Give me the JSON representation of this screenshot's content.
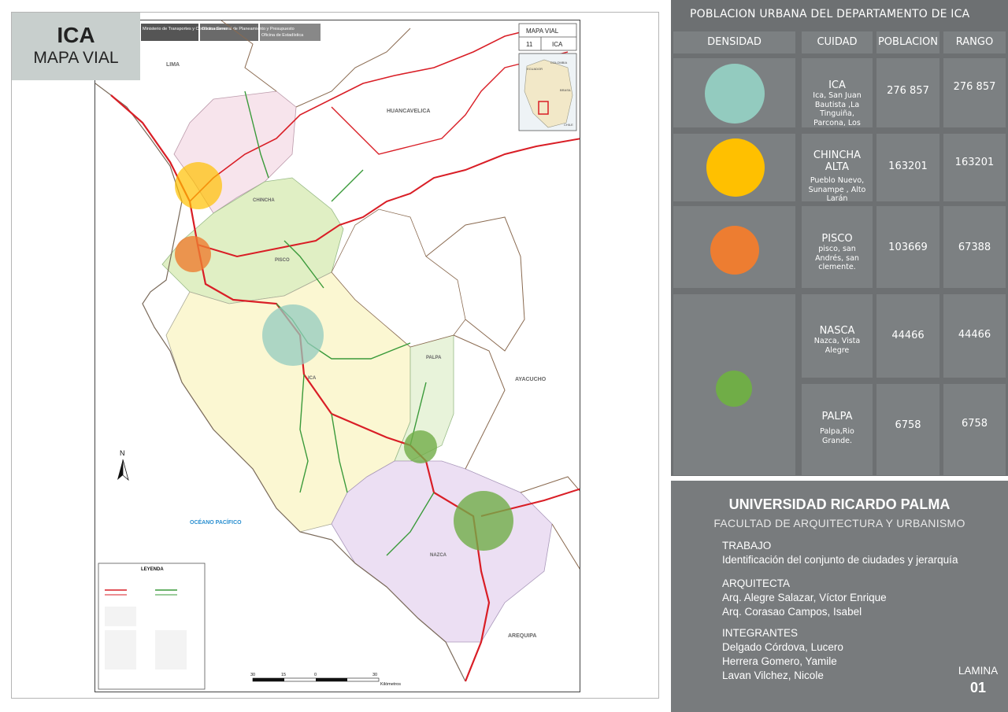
{
  "title": {
    "name": "ICA",
    "subtitle": "MAPA VIAL"
  },
  "map": {
    "header_logos": [
      "Ministerio de Transportes y Comunicaciones",
      "Oficina General de Planeamiento y Presupuesto",
      "Oficina de Estadística"
    ],
    "inset_label": "MAPA VIAL",
    "inset_number": "11",
    "inset_region": "ICA",
    "neighbors": [
      "LIMA",
      "HUANCAVELICA",
      "AYACUCHO",
      "AREQUIPA"
    ],
    "provinces": [
      "CHINCHA",
      "PISCO",
      "ICA",
      "PALPA",
      "NAZCA"
    ],
    "ocean": "OCÉANO PACÍFICO",
    "legend_title": "LEYENDA",
    "north": "N",
    "scale_ticks": [
      "30",
      "15",
      "0",
      "30"
    ],
    "scale_unit": "Kilómetros",
    "inset_countries": [
      "COLOMBIA",
      "ECUADOR",
      "BRASIL",
      "CHILE"
    ]
  },
  "panel": {
    "heading": "POBLACION  URBANA DEL DEPARTAMENTO DE ICA",
    "columns": [
      "DENSIDAD",
      "CUIDAD",
      "POBLACION",
      "RANGO"
    ],
    "rows": [
      {
        "city": "ICA",
        "detail": "Ica, San Juan Bautista ,La Tinguiña, Parcona, Los Aquijes , Pueblo Nuevo",
        "population": "276 857",
        "rank": "276 857",
        "color": "#93cbbf"
      },
      {
        "city": "CHINCHA ALTA",
        "detail": "Pueblo Nuevo, Sunampe , Alto Larán",
        "population": "163201",
        "rank": "163201",
        "color": "#ffc000"
      },
      {
        "city": "PISCO",
        "detail": "pisco, san Andrés, san clemente.",
        "population": "103669",
        "rank": "67388",
        "color": "#ed7d31"
      },
      {
        "city": "NASCA",
        "detail": "Nazca, Vista Alegre",
        "population": "44466",
        "rank": "44466",
        "color": "#70ad47"
      },
      {
        "city": "PALPA",
        "detail": "Palpa,Rio Grande.",
        "population": "6758",
        "rank": "6758",
        "color": "#70ad47"
      }
    ]
  },
  "footer": {
    "university": "UNIVERSIDAD RICARDO PALMA",
    "faculty": "FACULTAD DE ARQUITECTURA Y URBANISMO",
    "work_label": "TRABAJO",
    "work": "Identificación del conjunto de ciudades y jerarquía",
    "architect_label": "ARQUITECTA",
    "architects": [
      "Arq. Alegre Salazar, Víctor Enrique",
      "Arq. Corasao Campos, Isabel"
    ],
    "members_label": "INTEGRANTES",
    "members": [
      "Delgado Córdova, Lucero",
      "Herrera Gomero, Yamile",
      "Lavan Vilchez, Nicole"
    ],
    "sheet_label": "LAMINA",
    "sheet_number": "01"
  }
}
